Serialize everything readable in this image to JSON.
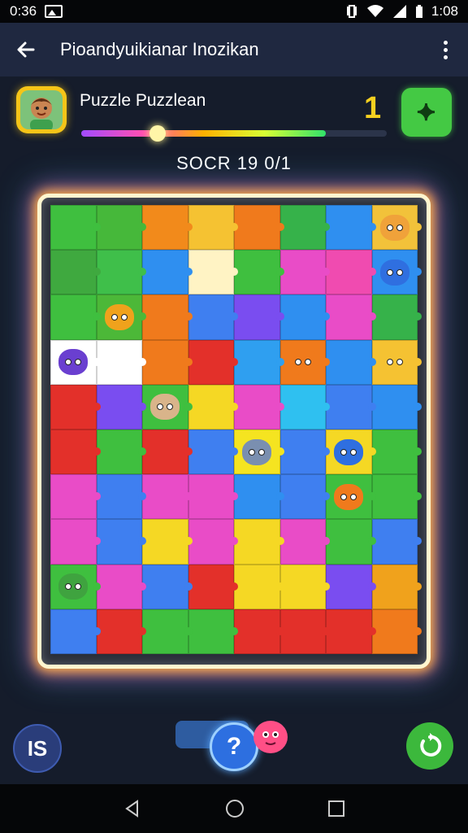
{
  "status_bar": {
    "time_left": "0:36",
    "time_right": "1:08",
    "icons": [
      "image-icon",
      "vibrate-icon",
      "wifi-icon",
      "signal-icon",
      "battery-icon"
    ]
  },
  "app_bar": {
    "title": "Pioandyuikianar Inozikan",
    "icons": [
      "back-arrow-icon",
      "more-vert-icon"
    ]
  },
  "player": {
    "name": "Puzzle Puzzlean",
    "level": "1",
    "progress": 0.25,
    "menu_icon": "grid-menu-icon",
    "menu_glyph": "⯌"
  },
  "score_text": "SOCR 19 0/1",
  "board": {
    "columns": 8,
    "rows": 10,
    "tile_colors": [
      [
        "#3fbf3f",
        "#46b83a",
        "#f28a1b",
        "#f5c232",
        "#f07a1c",
        "#36b24a",
        "#2f8ff0",
        "#f2c23a"
      ],
      [
        "#3fa93f",
        "#3fbf4a",
        "#2f8ff0",
        "#fff3c4",
        "#3fbf3f",
        "#e94cc7",
        "#f04bb0",
        "#2f8ff0"
      ],
      [
        "#3fbf3f",
        "#4cb838",
        "#f07a1c",
        "#3f7ff0",
        "#7a4df0",
        "#2f8ff0",
        "#e94cc7",
        "#36b24a"
      ],
      [
        "#ffffff",
        "#ffffff",
        "#f07a1c",
        "#e3302a",
        "#2f9ff0",
        "#f07a1c",
        "#2f8ff0",
        "#f5c232"
      ],
      [
        "#e3302a",
        "#7a4df0",
        "#3fbf3f",
        "#f5d824",
        "#e94cc7",
        "#2fc0f0",
        "#3f7ff0",
        "#2f8ff0"
      ],
      [
        "#e3302a",
        "#3fbf3f",
        "#e3302a",
        "#3f7ff0",
        "#f5e420",
        "#3f7ff0",
        "#f5d824",
        "#3fbf3f"
      ],
      [
        "#e94cc7",
        "#3f7ff0",
        "#e94cc7",
        "#e94cc7",
        "#2f8ff0",
        "#3f7ff0",
        "#3fbf3f",
        "#3fbf3f"
      ],
      [
        "#e94cc7",
        "#3f7ff0",
        "#f5d824",
        "#e94cc7",
        "#f5d824",
        "#e94cc7",
        "#3fbf3f",
        "#3f7ff0"
      ],
      [
        "#3fbf3f",
        "#e94cc7",
        "#3f7ff0",
        "#e3302a",
        "#f5d824",
        "#f5d824",
        "#7a4df0",
        "#f0a21c"
      ],
      [
        "#3f7ff0",
        "#e3302a",
        "#3fbf3f",
        "#3fbf3f",
        "#e3302a",
        "#e3302a",
        "#e3302a",
        "#f07a1c"
      ]
    ],
    "critters": [
      {
        "row": 0,
        "col": 7,
        "color": "#f0a23a"
      },
      {
        "row": 1,
        "col": 7,
        "color": "#2f6fe0"
      },
      {
        "row": 2,
        "col": 1,
        "color": "#f0a21c"
      },
      {
        "row": 3,
        "col": 0,
        "color": "#6a3fd0"
      },
      {
        "row": 3,
        "col": 5,
        "color": "#f07a1c"
      },
      {
        "row": 3,
        "col": 7,
        "color": "#f5c232"
      },
      {
        "row": 4,
        "col": 2,
        "color": "#d9b48a"
      },
      {
        "row": 5,
        "col": 4,
        "color": "#7a8fb0"
      },
      {
        "row": 5,
        "col": 6,
        "color": "#2f6fe0"
      },
      {
        "row": 6,
        "col": 6,
        "color": "#f07a1c"
      },
      {
        "row": 8,
        "col": 0,
        "color": "#3fa33f"
      }
    ]
  },
  "bottom": {
    "is_label": "IS",
    "hint_label": "?",
    "restart_icon": "restart-icon"
  },
  "nav": {
    "icons": [
      "nav-back-icon",
      "nav-home-icon",
      "nav-recents-icon"
    ]
  },
  "colors": {
    "background": "#151c2b",
    "app_bar": "#1f2840",
    "level_yellow": "#f5d020",
    "menu_green": "#44c944"
  }
}
